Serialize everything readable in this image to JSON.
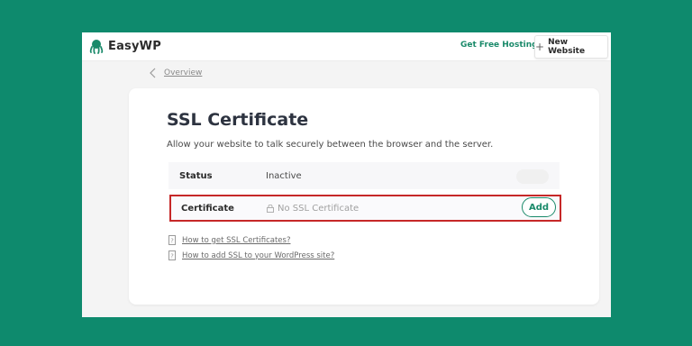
{
  "header": {
    "brand": "EasyWP",
    "free_hosting": "Get Free Hosting",
    "new_website": "New Website"
  },
  "breadcrumb": {
    "label": "Overview"
  },
  "card": {
    "title": "SSL Certificate",
    "subtitle": "Allow your website to talk securely between the browser and the server.",
    "status": {
      "label": "Status",
      "value": "Inactive"
    },
    "certificate": {
      "label": "Certificate",
      "value": "No SSL Certificate",
      "action": "Add"
    },
    "help_links": [
      "How to get SSL Certificates?",
      "How to add SSL to your WordPress site?"
    ]
  },
  "colors": {
    "background": "#0e8a6d",
    "accent": "#1a8a6a",
    "highlight_border": "#c62828"
  }
}
